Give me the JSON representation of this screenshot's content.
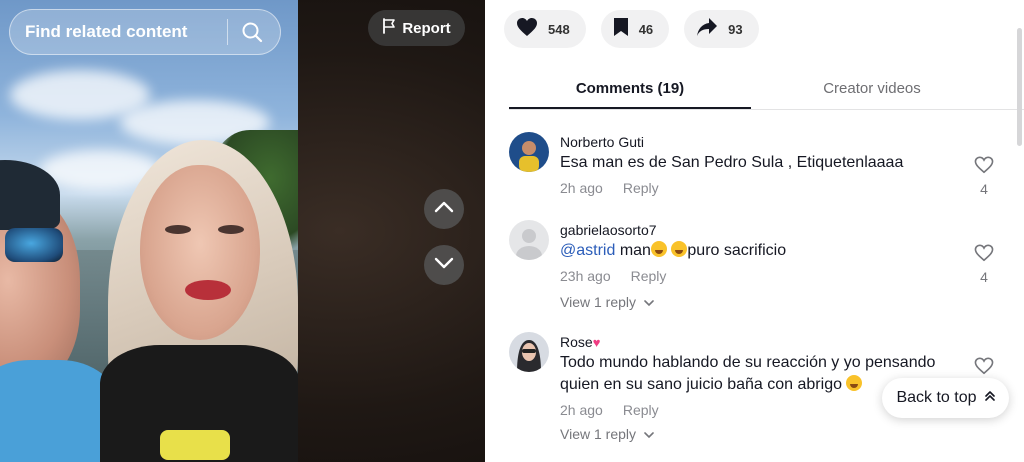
{
  "search": {
    "placeholder": "Find related content",
    "icon": "search-icon"
  },
  "report": {
    "label": "Report",
    "icon": "flag-icon"
  },
  "nav": {
    "up_icon": "chevron-up-icon",
    "down_icon": "chevron-down-icon"
  },
  "actions": [
    {
      "icon": "heart-icon",
      "count": "548"
    },
    {
      "icon": "bookmark-icon",
      "count": "46"
    },
    {
      "icon": "share-icon",
      "count": "93"
    }
  ],
  "tabs": [
    {
      "label": "Comments (19)",
      "active": true
    },
    {
      "label": "Creator videos",
      "active": false
    }
  ],
  "comments": [
    {
      "user": "Norberto Guti",
      "text": "Esa man es de San Pedro Sula , Etiquetenlaaaa",
      "time": "2h ago",
      "reply": "Reply",
      "likes": "4",
      "view_replies": ""
    },
    {
      "user": "gabrielaosorto7",
      "mention": "@astrid",
      "text_a": " man",
      "text_b": "puro sacrificio",
      "time": "23h ago",
      "reply": "Reply",
      "likes": "4",
      "view_replies": "View 1 reply"
    },
    {
      "user": "Rose",
      "text": "Todo mundo hablando de su reacción y yo pensando quien en su sano juicio baña con abrigo",
      "time": "2h ago",
      "reply": "Reply",
      "likes": "",
      "view_replies": "View 1 reply"
    }
  ],
  "back_to_top": {
    "label": "Back to top"
  },
  "colors": {
    "accent": "#161823",
    "mention": "#2b5db9",
    "muted": "#8a8b91"
  }
}
